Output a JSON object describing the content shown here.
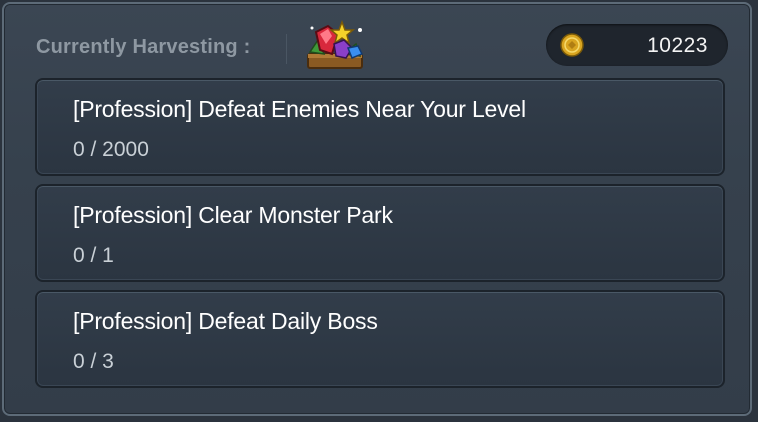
{
  "header": {
    "harvest_label": "Currently Harvesting :",
    "harvest_icon": "gem-pile-icon",
    "coin_icon": "gold-coin-icon",
    "coin_value": "10223"
  },
  "quests": [
    {
      "title": "[Profession] Defeat Enemies Near Your Level",
      "progress": "0 / 2000",
      "current": 0,
      "goal": 2000
    },
    {
      "title": "[Profession] Clear Monster Park",
      "progress": "0 / 1",
      "current": 0,
      "goal": 1
    },
    {
      "title": "[Profession] Defeat Daily Boss",
      "progress": "0 / 3",
      "current": 0,
      "goal": 3
    }
  ],
  "colors": {
    "panel_bg": "#36414d",
    "card_bg": "#2e3844",
    "label_gray": "#8e98a2",
    "coin_gold": "#d9a520"
  }
}
